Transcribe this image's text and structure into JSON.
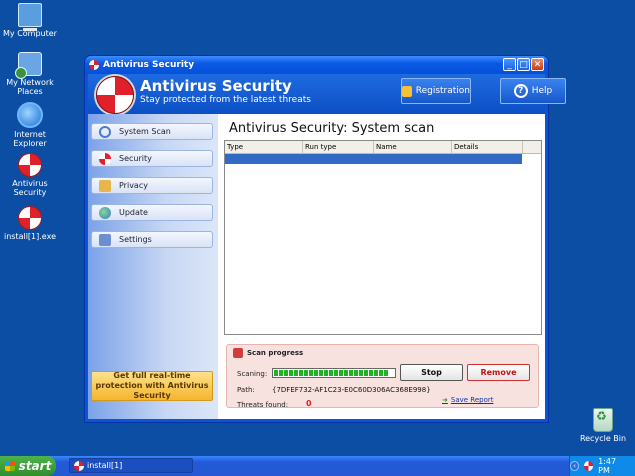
{
  "desktop": {
    "icons": [
      {
        "label": "My Computer",
        "icon": "computer-icon"
      },
      {
        "label": "My Network Places",
        "icon": "network-icon"
      },
      {
        "label": "Internet Explorer",
        "icon": "internet-explorer-icon"
      },
      {
        "label": "Antivirus Security",
        "icon": "antivirus-shield-icon"
      },
      {
        "label": "install[1].exe",
        "icon": "installer-shield-icon"
      },
      {
        "label": "Recycle Bin",
        "icon": "recycle-bin-icon"
      }
    ]
  },
  "window": {
    "title": "Antivirus Security",
    "controls": {
      "minimize": "_",
      "maximize": "□",
      "close": "✕"
    }
  },
  "header": {
    "title": "Antivirus Security",
    "subtitle": "Stay protected from the latest threats",
    "registration_label": "Registration",
    "help_label": "Help"
  },
  "sidebar": {
    "items": [
      {
        "label": "System Scan",
        "icon": "magnifier-icon"
      },
      {
        "label": "Security",
        "icon": "shield-icon"
      },
      {
        "label": "Privacy",
        "icon": "privacy-icon"
      },
      {
        "label": "Update",
        "icon": "globe-update-icon"
      },
      {
        "label": "Settings",
        "icon": "settings-icon"
      }
    ],
    "promo": "Get full real-time protection with Antivirus Security"
  },
  "main": {
    "title": "Antivirus Security: System scan",
    "table": {
      "columns": [
        "Type",
        "Run type",
        "Name",
        "Details"
      ]
    }
  },
  "scan": {
    "heading": "Scan progress",
    "scanning_label": "Scaning:",
    "progress_fraction": 0.96,
    "path_label": "Path:",
    "path_value": "{7DFEF732-AF1C23-E0C60D306AC368E998}",
    "threats_label": "Threats found:",
    "threats_value": "0",
    "stop_label": "Stop",
    "remove_label": "Remove",
    "save_report_label": "Save Report"
  },
  "taskbar": {
    "start_label": "start",
    "task_label": "install[1]",
    "clock": "1:47 PM"
  },
  "colors": {
    "desktop": "#0c4ea3",
    "titlebar": "#0a5ae6",
    "accent_red": "#e0202a",
    "progress_green": "#22b024",
    "selection": "#316ac5"
  }
}
